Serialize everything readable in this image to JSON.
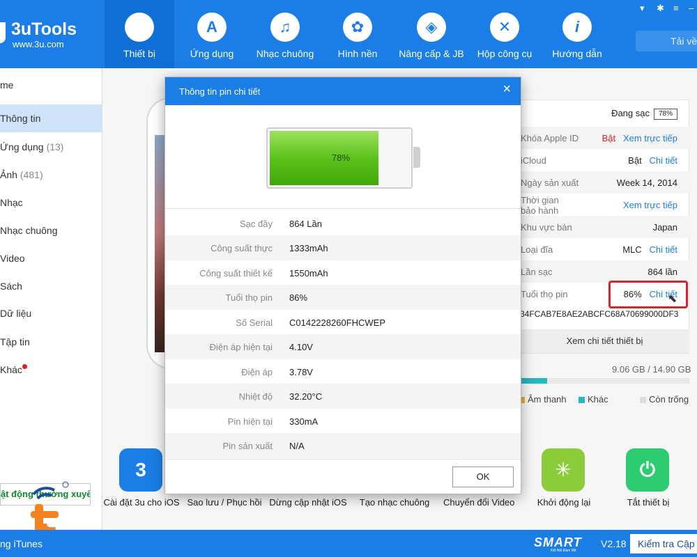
{
  "app": {
    "name": "3uTools",
    "url": "www.3u.com"
  },
  "nav": [
    {
      "label": "Thiết bị",
      "icon": "apple-icon"
    },
    {
      "label": "Ứng dụng",
      "icon": "app-store-icon"
    },
    {
      "label": "Nhạc chuông",
      "icon": "bell-icon"
    },
    {
      "label": "Hình nền",
      "icon": "flower-icon"
    },
    {
      "label": "Nâng cấp & JB",
      "icon": "box-icon"
    },
    {
      "label": "Hộp công cụ",
      "icon": "tools-icon"
    },
    {
      "label": "Hướng dẫn",
      "icon": "info-icon"
    }
  ],
  "topbar": {
    "download_label": "Tải về"
  },
  "sidebar": {
    "items": [
      {
        "label": "me",
        "count": ""
      },
      {
        "label": "Thông tin",
        "count": ""
      },
      {
        "label": "Ứng dụng",
        "count": "(13)"
      },
      {
        "label": "Ảnh",
        "count": "(481)"
      },
      {
        "label": "Nhạc",
        "count": ""
      },
      {
        "label": "Nhạc chuông",
        "count": ""
      },
      {
        "label": "Video",
        "count": ""
      },
      {
        "label": "Sách",
        "count": ""
      },
      {
        "label": "Dữ liệu",
        "count": ""
      },
      {
        "label": "Tập tin",
        "count": ""
      },
      {
        "label": "Khác",
        "count": ""
      }
    ],
    "bottom_button": "ật động thường xuyê"
  },
  "info": {
    "charging_label": "Đang sạc",
    "charging_value": "78%",
    "rows": [
      {
        "key": "Khóa Apple ID",
        "value": "Bật",
        "link": "Xem trực tiếp"
      },
      {
        "key": "iCloud",
        "value": "Bật",
        "link": "Chi tiết"
      },
      {
        "key": "Ngày sản xuất",
        "value": "Week 14, 2014",
        "link": ""
      },
      {
        "key": "Thời gian bảo hành",
        "value": "",
        "link": "Xem trực tiếp"
      },
      {
        "key": "Khu vực bán",
        "value": "Japan",
        "link": ""
      },
      {
        "key": "Loại đĩa",
        "value": "MLC",
        "link": "Chi tiết"
      },
      {
        "key": "Lần sạc",
        "value": "864 lần",
        "link": ""
      },
      {
        "key": "Tuổi thọ pin",
        "value": "86%",
        "link": "Chi tiết"
      }
    ],
    "serial": "34FCAB7E8AE2ABCFC68A70699000DF3",
    "detail_button": "Xem chi tiết thiết bị",
    "storage": "9.06 GB / 14.90 GB",
    "storage_used_fraction": 0.16,
    "legend": [
      {
        "label": "Âm thanh",
        "color": "#e8b02a"
      },
      {
        "label": "Khác",
        "color": "#22b8c6"
      },
      {
        "label": "Còn trống",
        "color": "#dddddd"
      }
    ]
  },
  "tools": [
    {
      "label": "Cài đặt 3u cho iOS",
      "glyph": "3",
      "color": "#1a7ee6"
    },
    {
      "label": "Sao lưu / Phục hồi",
      "glyph": "",
      "color": "#ffffff"
    },
    {
      "label": "Dừng cập nhật iOS",
      "glyph": "",
      "color": "#ffffff"
    },
    {
      "label": "Tạo nhạc chuông",
      "glyph": "",
      "color": "#ffffff"
    },
    {
      "label": "Chuyển đổi Video",
      "glyph": "",
      "color": "#ffffff"
    },
    {
      "label": "Khởi động lại",
      "glyph": "✳",
      "color": "#8ccc3a"
    },
    {
      "label": "Tắt thiết bị",
      "glyph": "⏻",
      "color": "#2ecc71"
    }
  ],
  "modal": {
    "title": "Thông tin pin chi tiết",
    "battery_percent": "78%",
    "battery_fraction": 0.78,
    "rows": [
      {
        "key": "Sạc đầy",
        "value": "864 Lần"
      },
      {
        "key": "Công suất thực",
        "value": "1333mAh"
      },
      {
        "key": "Công suất thiết kế",
        "value": "1550mAh"
      },
      {
        "key": "Tuổi thọ pin",
        "value": "86%"
      },
      {
        "key": "Số Serial",
        "value": "C0142228260FHCWEP"
      },
      {
        "key": "Điện áp hiện tại",
        "value": "4.10V"
      },
      {
        "key": "Điện áp",
        "value": "3.78V"
      },
      {
        "key": "Nhiệt độ",
        "value": "32.20°C"
      },
      {
        "key": "Pin hiện tại",
        "value": "330mA"
      },
      {
        "key": "Pin sản xuất",
        "value": "N/A"
      }
    ],
    "ok_label": "OK"
  },
  "bottombar": {
    "itunes": "ng iTunes",
    "brand": "SMART",
    "brand_sub": "Kết Nối Đam Mê",
    "version": "V2.18",
    "update_label": "Kiểm tra Cập nhật"
  }
}
